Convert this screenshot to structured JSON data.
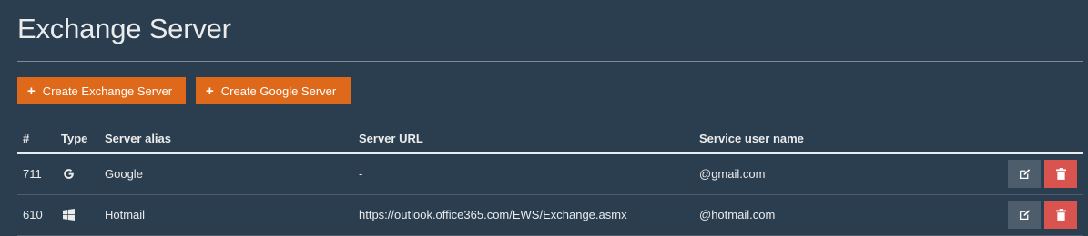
{
  "page": {
    "title": "Exchange Server"
  },
  "toolbar": {
    "create_exchange_label": "Create Exchange Server",
    "create_google_label": "Create Google Server"
  },
  "table": {
    "headers": {
      "id": "#",
      "type": "Type",
      "alias": "Server alias",
      "url": "Server URL",
      "user": "Service user name"
    },
    "rows": [
      {
        "id": "711",
        "type_icon": "google-icon",
        "alias": "Google",
        "url": "-",
        "user": "@gmail.com"
      },
      {
        "id": "610",
        "type_icon": "windows-icon",
        "alias": "Hotmail",
        "url": "https://outlook.office365.com/EWS/Exchange.asmx",
        "user": "@hotmail.com"
      }
    ]
  },
  "colors": {
    "background": "#2b3e50",
    "accent": "#df691a",
    "danger": "#d9534f",
    "secondary": "#4e5d6c"
  }
}
